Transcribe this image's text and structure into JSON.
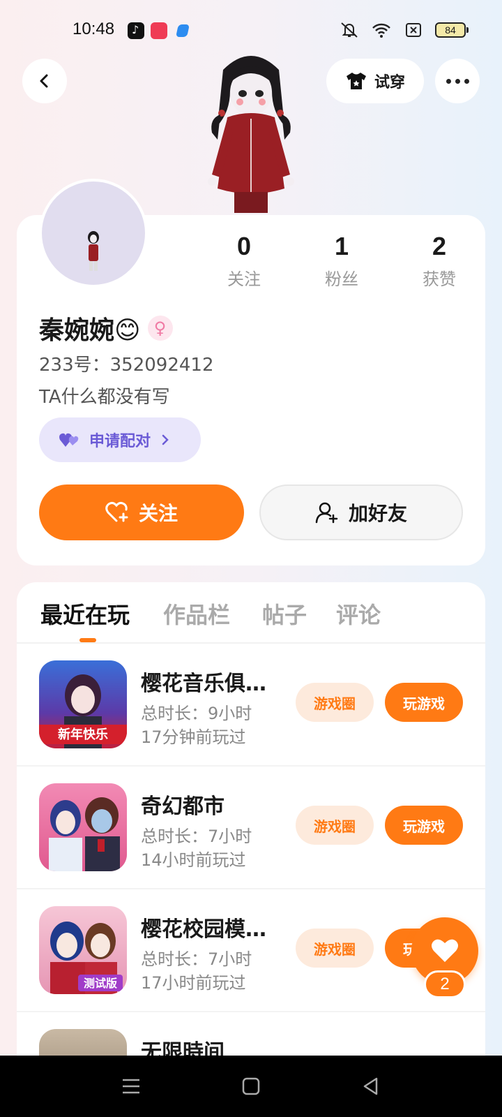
{
  "status_bar": {
    "time": "10:48",
    "battery": "84",
    "icons": [
      "tiktok-icon",
      "app-icon-red",
      "app-icon-blue",
      "mute-icon",
      "wifi-icon",
      "sim-icon",
      "battery-icon"
    ]
  },
  "header": {
    "try_on_label": "试穿"
  },
  "profile": {
    "stats": [
      {
        "value": "0",
        "label": "关注"
      },
      {
        "value": "1",
        "label": "粉丝"
      },
      {
        "value": "2",
        "label": "获赞"
      }
    ],
    "name": "秦婉婉😊",
    "gender_symbol": "♀",
    "uid": "233号：352092412",
    "bio": "TA什么都没有写",
    "pair_label": "申请配对",
    "follow_label": "关注",
    "add_friend_label": "加好友"
  },
  "tabs": [
    "最近在玩",
    "作品栏",
    "帖子",
    "评论"
  ],
  "games": [
    {
      "name": "樱花音乐俱…",
      "duration": "总时长：9小时",
      "last_played": "17分钟前玩过",
      "circle_label": "游戏圈",
      "play_label": "玩游戏"
    },
    {
      "name": "奇幻都市",
      "duration": "总时长：7小时",
      "last_played": "14小时前玩过",
      "circle_label": "游戏圈",
      "play_label": "玩游戏"
    },
    {
      "name": "樱花校园模…",
      "duration": "总时长：7小时",
      "last_played": "17小时前玩过",
      "circle_label": "游戏圈",
      "play_label": "玩游戏"
    },
    {
      "name": "无限時间",
      "duration": "",
      "last_played": "",
      "circle_label": "",
      "play_label": ""
    }
  ],
  "float_like": {
    "count": "2"
  },
  "colors": {
    "accent": "#ff7a14",
    "pair": "#6b5bd6",
    "pair_bg": "#e9e6fb"
  }
}
